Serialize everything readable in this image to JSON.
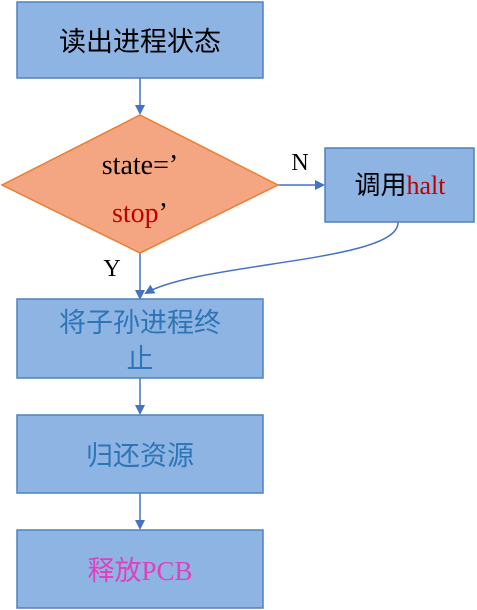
{
  "colors": {
    "box_fill": "#8eb4e3",
    "box_stroke": "#4f81bd",
    "diamond_fill": "#f4a582",
    "diamond_stroke": "#ed7d31",
    "arrow": "#4472c4",
    "text_dark": "#000000",
    "text_red": "#c00000",
    "text_blue": "#2e75b6",
    "text_magenta": "#e040c0"
  },
  "nodes": {
    "read_state": {
      "label": "读出进程状态"
    },
    "decision": {
      "line1": "state=’",
      "line2_main": "stop",
      "line2_tail": "’"
    },
    "call_halt": {
      "label_cn": "调用",
      "label_en": "halt"
    },
    "terminate_children": {
      "line1": "将子孙进程终",
      "line2": "止"
    },
    "return_resources": {
      "label": "归还资源"
    },
    "release_pcb": {
      "label_cn": "释放",
      "label_en": "PCB"
    }
  },
  "edge_labels": {
    "no": "N",
    "yes": "Y"
  }
}
